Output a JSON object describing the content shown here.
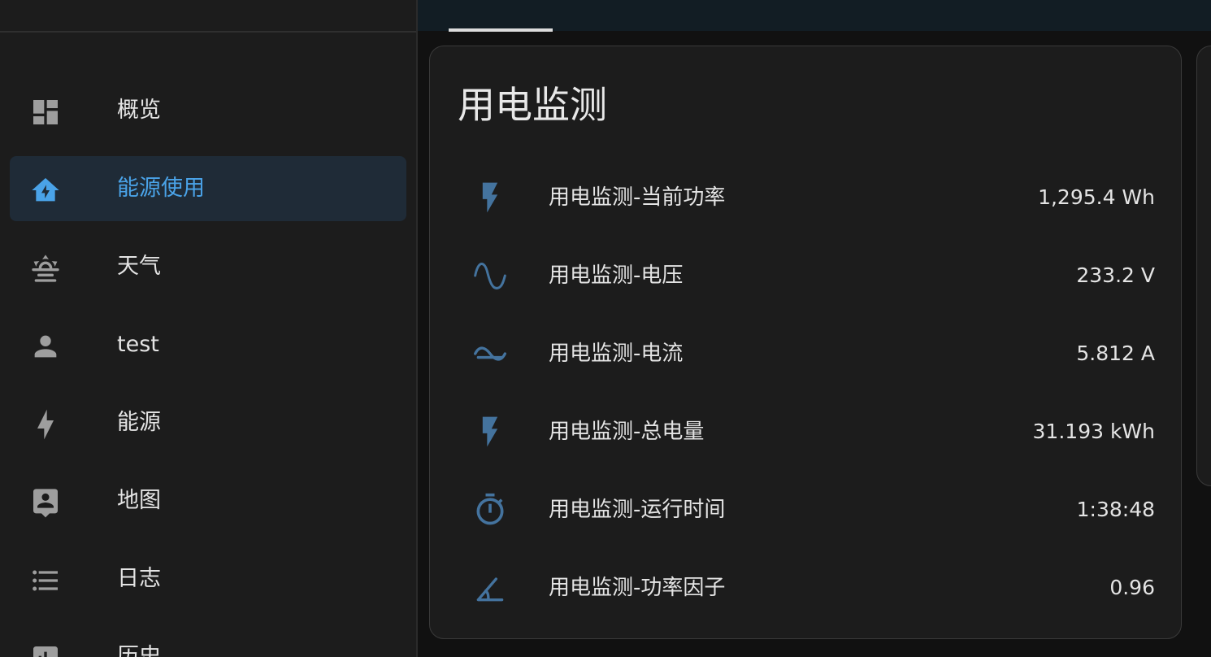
{
  "sidebar": {
    "items": [
      {
        "label": "概览",
        "icon": "dashboard-icon",
        "active": false
      },
      {
        "label": "能源使用",
        "icon": "home-lightning-icon",
        "active": true
      },
      {
        "label": "天气",
        "icon": "weather-sunset-icon",
        "active": false
      },
      {
        "label": "test",
        "icon": "account-icon",
        "active": false
      },
      {
        "label": "能源",
        "icon": "lightning-bolt-icon",
        "active": false
      },
      {
        "label": "地图",
        "icon": "map-person-icon",
        "active": false
      },
      {
        "label": "日志",
        "icon": "format-list-icon",
        "active": false
      },
      {
        "label": "历史",
        "icon": "chart-box-icon",
        "active": false
      }
    ]
  },
  "colors": {
    "accent": "#4aa3e8",
    "entity_icon": "#44739e",
    "nav_icon": "#9e9e9e"
  },
  "card": {
    "title": "用电监测",
    "entities": [
      {
        "name": "用电监测-当前功率",
        "value": "1,295.4 Wh",
        "icon": "flash-icon"
      },
      {
        "name": "用电监测-电压",
        "value": "233.2 V",
        "icon": "sine-wave-icon"
      },
      {
        "name": "用电监测-电流",
        "value": "5.812 A",
        "icon": "current-ac-icon"
      },
      {
        "name": "用电监测-总电量",
        "value": "31.193 kWh",
        "icon": "flash-icon"
      },
      {
        "name": "用电监测-运行时间",
        "value": "1:38:48",
        "icon": "timer-icon"
      },
      {
        "name": "用电监测-功率因子",
        "value": "0.96",
        "icon": "angle-acute-icon"
      }
    ]
  }
}
